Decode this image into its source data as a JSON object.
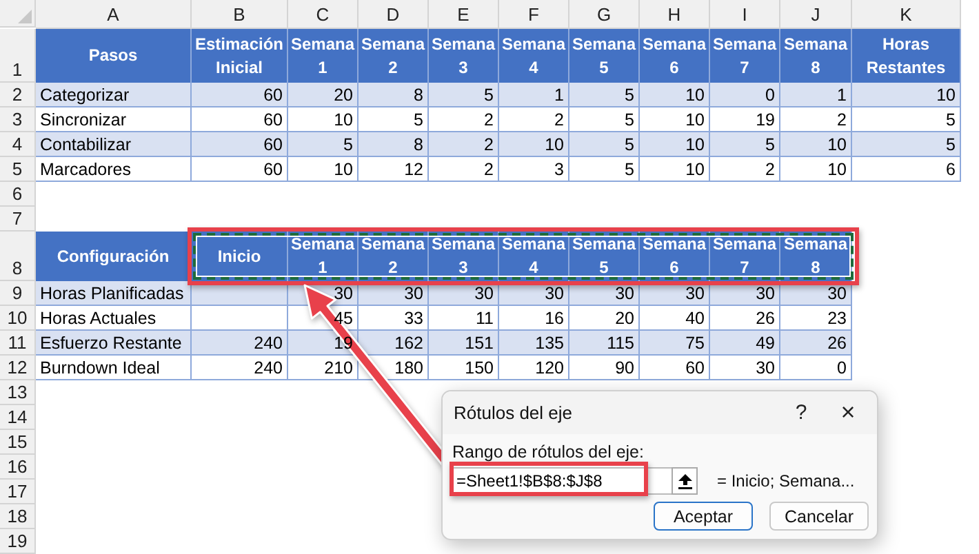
{
  "column_headers": [
    "A",
    "B",
    "C",
    "D",
    "E",
    "F",
    "G",
    "H",
    "I",
    "J",
    "K"
  ],
  "row_numbers": [
    "1",
    "2",
    "3",
    "4",
    "5",
    "6",
    "7",
    "8",
    "9",
    "10",
    "11",
    "12",
    "13",
    "14",
    "15",
    "16",
    "17",
    "18",
    "19"
  ],
  "table_1": {
    "columns": [
      "Pasos",
      "Estimación Inicial",
      "Semana 1",
      "Semana 2",
      "Semana 3",
      "Semana 4",
      "Semana 5",
      "Semana 6",
      "Semana 7",
      "Semana 8",
      "Horas Restantes"
    ],
    "rows": [
      [
        "Categorizar",
        "60",
        "20",
        "8",
        "5",
        "1",
        "5",
        "10",
        "0",
        "1",
        "10"
      ],
      [
        "Sincronizar",
        "60",
        "10",
        "5",
        "2",
        "2",
        "5",
        "10",
        "19",
        "2",
        "5"
      ],
      [
        "Contabilizar",
        "60",
        "5",
        "8",
        "2",
        "10",
        "5",
        "10",
        "5",
        "10",
        "5"
      ],
      [
        "Marcadores",
        "60",
        "10",
        "12",
        "2",
        "3",
        "5",
        "10",
        "2",
        "10",
        "6"
      ]
    ]
  },
  "table_2": {
    "columns": [
      "Configuración",
      "Inicio",
      "Semana 1",
      "Semana 2",
      "Semana 3",
      "Semana 4",
      "Semana 5",
      "Semana 6",
      "Semana 7",
      "Semana 8"
    ],
    "rows": [
      [
        "Horas Planificadas",
        null,
        "30",
        "30",
        "30",
        "30",
        "30",
        "30",
        "30",
        "30"
      ],
      [
        "Horas Actuales",
        null,
        "45",
        "33",
        "11",
        "16",
        "20",
        "40",
        "26",
        "23"
      ],
      [
        "Esfuerzo Restante",
        "240",
        "19",
        "162",
        "151",
        "135",
        "115",
        "75",
        "49",
        "26"
      ],
      [
        "Burndown Ideal",
        "240",
        "210",
        "180",
        "150",
        "120",
        "90",
        "60",
        "30",
        "0"
      ]
    ]
  },
  "dialog": {
    "title": "Rótulos del eje",
    "help": "?",
    "close": "×",
    "field_label": "Rango de rótulos del eje:",
    "field_value": "=Sheet1!$B$8:$J$8",
    "preview": "= Inicio; Semana...",
    "buttons": [
      {
        "label": "Aceptar",
        "default": true
      },
      {
        "label": "Cancelar",
        "default": false
      }
    ]
  }
}
